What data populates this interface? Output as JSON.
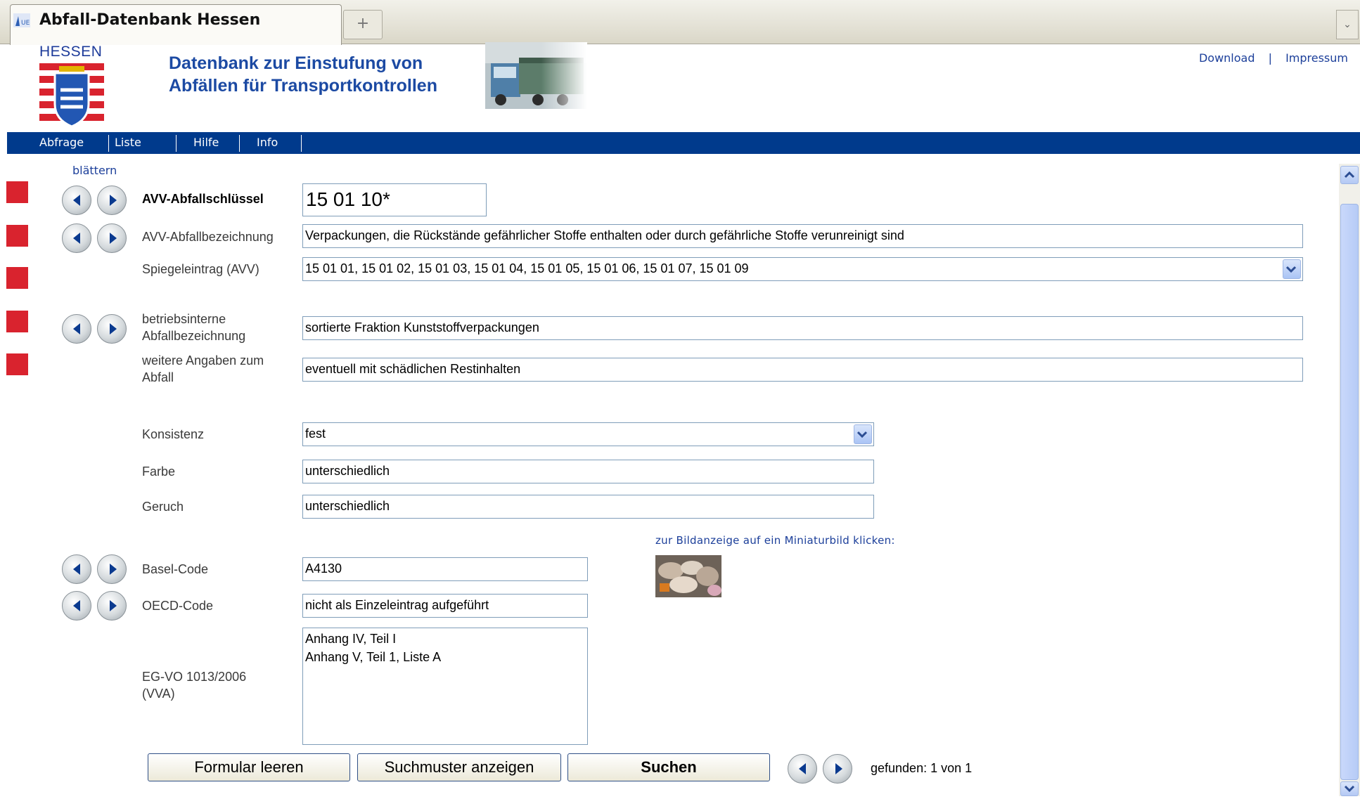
{
  "browser": {
    "tab_title": "Abfall-Datenbank Hessen",
    "new_tab_symbol": "+",
    "tab_menu_symbol": "⌄",
    "tab_icon": "site-favicon-icon"
  },
  "header": {
    "logo_text": "HESSEN",
    "title_line1": "Datenbank zur Einstufung von",
    "title_line2": "Abfällen für Transportkontrollen",
    "links": [
      "Download",
      "Impressum"
    ],
    "separator": "|"
  },
  "nav": {
    "items": [
      "Abfrage",
      "Liste",
      "Hilfe",
      "Info"
    ]
  },
  "form": {
    "blaettern_label": "blättern",
    "avv_key": {
      "label": "AVV-Abfallschlüssel",
      "value": "15 01 10*"
    },
    "avv_name": {
      "label": "AVV-Abfallbezeichnung",
      "value": "Verpackungen, die Rückstände gefährlicher Stoffe enthalten oder durch gefährliche Stoffe verunreinigt sind"
    },
    "mirror": {
      "label": "Spiegeleintrag (AVV)",
      "value": "15 01 01, 15 01 02, 15 01 03, 15 01 04, 15 01 05, 15 01 06, 15 01 07, 15 01 09"
    },
    "internal_name": {
      "label_line1": "betriebsinterne",
      "label_line2": "Abfallbezeichnung",
      "value": "sortierte Fraktion Kunststoffverpackungen"
    },
    "further_info": {
      "label_line1": "weitere Angaben zum",
      "label_line2": "Abfall",
      "value": "eventuell mit schädlichen Restinhalten"
    },
    "consistency": {
      "label": "Konsistenz",
      "value": "fest"
    },
    "color": {
      "label": "Farbe",
      "value": "unterschiedlich"
    },
    "smell": {
      "label": "Geruch",
      "value": "unterschiedlich"
    },
    "thumb_hint": "zur Bildanzeige auf ein Miniaturbild klicken:",
    "basel": {
      "label": "Basel-Code",
      "value": "A4130"
    },
    "oecd": {
      "label": "OECD-Code",
      "value": "nicht als Einzeleintrag aufgeführt"
    },
    "eg_vo": {
      "label_line1": "EG-VO 1013/2006",
      "label_line2": "(VVA)",
      "lines": [
        "Anhang IV, Teil I",
        "Anhang V, Teil 1, Liste A"
      ]
    }
  },
  "buttons": {
    "clear": "Formular leeren",
    "show_pattern": "Suchmuster anzeigen",
    "search": "Suchen"
  },
  "result": {
    "text": "gefunden: 1 von 1"
  },
  "colors": {
    "nav_bar": "#003a8c",
    "marker": "#d9232e",
    "title_blue": "#1c4aa3"
  }
}
